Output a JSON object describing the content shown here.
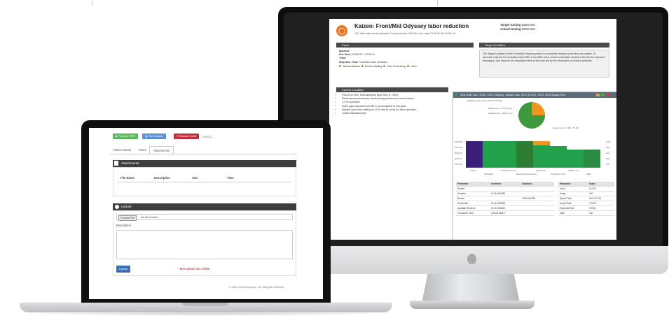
{
  "monitor": {
    "title": "Kaizen: Front/Mid Odyssey labor reduction",
    "subtitle": "VIC International Automation Components USA IAL Jun date 20 9:34:18 10:05:19",
    "target_saving_label": "Target Saving",
    "target_saving_value": "$283,000",
    "actual_saving_label": "Actual Saving",
    "actual_saving_value": "$300,000",
    "facts_header": "Facts",
    "target_header": "Target Condition",
    "facts": {
      "sponsor_label": "Sponsor:",
      "due_date_label": "Due Date:",
      "due_date_value": "2/19/2017 1:00:00 M",
      "team_label": "Team:",
      "step_label": "Step Idea - Sub:",
      "step_value": "Front/Mid Labor reduction",
      "tags": [
        "Standardization",
        "Excess Waiting",
        "Over Processing",
        "Labor"
      ]
    },
    "target_text": "The Target condition of the Front/Mid Odyssey project is to achieve reduced cycle time per project: 10 seconds. Improve the operation takt (TBD) in the 68% more; reduce redundant checks in the line for improved throughput, and improve the employee trend in the work aid by the elimination of needed activities.",
    "current_header": "Current Condition",
    "current_items": [
      "Flow is on time, final assembly cycle time is - 6R.8",
      "Redundant/unnecessary checks being performed at each station",
      "2.4 HI operation",
      "Some gaps reported from 8R in as compared to real goal",
      "Wasted cycle time waiting on GCH due to check for each operation",
      "Limited standard work"
    ],
    "plugin_title": "Work Mode: Calc - 19-08 - 10:00:1 Odyssey - Machine Data - 00:10:19 to 06 - 10:00 - 08:02 Seaway Time",
    "pie_labels": [
      "Machine Cycle Time: 96.47% (OCPS)",
      "Speed Loss: 1.77% (nne)",
      "Quality Loss: 1.35% (nne)",
      "Speed Loss 1 3.4% - 73.3%"
    ],
    "bar_labels": [
      "Output",
      "Available Runtime",
      "Speed Loss",
      "Quality Loss",
      "Scheduled",
      "Downtime Performance",
      "Production Time",
      "OEE"
    ],
    "y_ticks": [
      "100%",
      "80%",
      "60%",
      "40%",
      "20%"
    ],
    "y_left_ticks": [
      "22200.00",
      "55100.00",
      "80000.00",
      "00:00.00",
      "42100.00"
    ],
    "table_left_headers": [
      "Parameter",
      "Unfolded",
      "Unfolded"
    ],
    "table_left_rows": [
      [
        "Shared",
        "",
        ""
      ],
      [
        "Duration",
        "HH:24:38.888",
        ""
      ],
      [
        "Breaks",
        "",
        "24:98 34.888"
      ],
      [
        "Scheduled",
        "HH:24:38.888",
        ""
      ],
      [
        "Available Runtime",
        "HH:24:38.888",
        ""
      ],
      [
        "Production Time",
        "ZZ8:26:38.877",
        ""
      ]
    ],
    "table_right_headers": [
      "Parameter",
      "Value"
    ],
    "table_right_rows": [
      [
        "Good",
        "12.0%"
      ],
      [
        "Scrap",
        "100"
      ],
      [
        "Speed Time",
        "00:01:22:18"
      ],
      [
        "Actual Rate",
        "0.7823"
      ],
      [
        "Expected Rate",
        "0.7961"
      ],
      [
        "Ideal",
        "100"
      ]
    ]
  },
  "laptop": {
    "buttons": [
      "Preview PDF",
      "Print Kaizen",
      "Discard Draft"
    ],
    "saving_text": "Saving...",
    "tabs": [
      "Kaizen Detail",
      "Share",
      "Attachments"
    ],
    "attachments_header": "Attachments",
    "table_headers": [
      "File Name",
      "Description",
      "Size",
      "Time"
    ],
    "upload_header": "Upload",
    "choose_file_button": "Choose File",
    "no_file_text": "No file chosen",
    "description_label": "Description",
    "upload_button": "Upload",
    "max_size_text": "* Max upload size 20MB",
    "footer_text": "© 2002-2018 Shopogix, Inc. All rights reserved"
  },
  "colors": {
    "preview_btn": "#5cb85c",
    "print_btn": "#5b8fd6",
    "discard_btn": "#c0303e",
    "upload_btn": "#3c6fb3",
    "accent_orange": "#e87722",
    "pie_green": "#3c9a3c",
    "pie_orange": "#f0961e",
    "bar_purple": "#3a1f7a",
    "bar_green": "#23a04c"
  }
}
